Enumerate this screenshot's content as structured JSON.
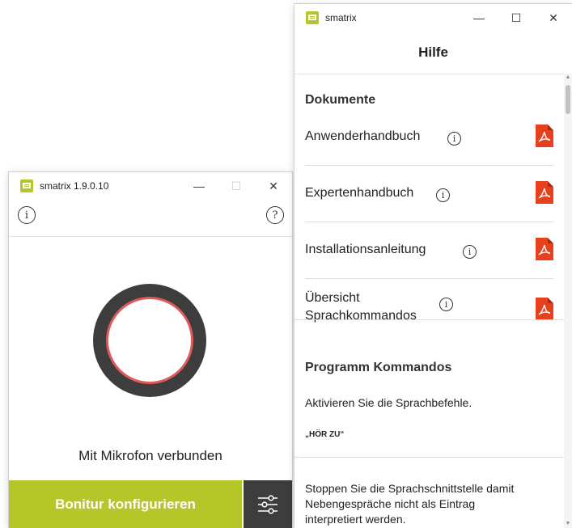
{
  "main_window": {
    "title": "smatrix 1.9.0.10",
    "minimize_glyph": "—",
    "maximize_glyph": "☐",
    "close_glyph": "✕",
    "info_glyph": "i",
    "help_glyph": "?",
    "status_text": "Mit Mikrofon verbunden",
    "configure_button": "Bonitur konfigurieren",
    "accent_color": "#b5c628",
    "mic_ring_color": "#3d3d3d",
    "mic_indicator_color": "#e05a5a",
    "icons": [
      "app-logo-icon",
      "info-icon",
      "help-icon",
      "microphone-indicator-icon",
      "settings-sliders-icon"
    ]
  },
  "help_window": {
    "title": "smatrix",
    "minimize_glyph": "—",
    "maximize_glyph": "☐",
    "close_glyph": "✕",
    "header": "Hilfe",
    "documents_section": "Dokumente",
    "documents": [
      {
        "label": "Anwenderhandbuch",
        "info_glyph": "i"
      },
      {
        "label": "Expertenhandbuch",
        "info_glyph": "i"
      },
      {
        "label": "Installationsanleitung",
        "info_glyph": "i"
      },
      {
        "label_line1": "Übersicht",
        "label_line2": "Sprachkommandos",
        "info_glyph": "i"
      }
    ],
    "commands_section": "Programm Kommandos",
    "commands": [
      {
        "description": "Aktivieren Sie die Sprachbefehle.",
        "command": "„HÖR ZU“"
      },
      {
        "description_line1": "Stoppen Sie die Sprachschnittstelle damit",
        "description_line2": "Nebengespräche nicht als Eintrag",
        "description_line3": "interpretiert werden."
      }
    ],
    "pdf_color": "#e8401c",
    "icons": [
      "app-logo-icon",
      "info-icon",
      "pdf-icon",
      "scroll-up-arrow-icon",
      "scroll-down-arrow-icon"
    ]
  }
}
